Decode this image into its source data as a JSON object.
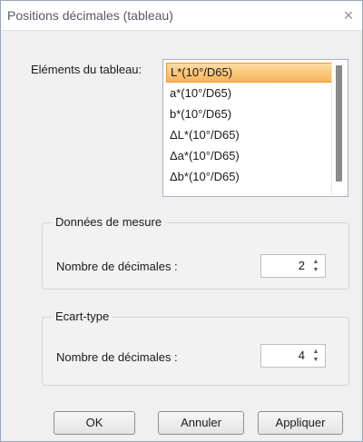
{
  "window": {
    "title": "Positions décimales (tableau)",
    "close_glyph": "×"
  },
  "elements": {
    "label": "Eléments du tableau:",
    "items": [
      {
        "label": "L*(10°/D65)",
        "selected": true
      },
      {
        "label": "a*(10°/D65)",
        "selected": false
      },
      {
        "label": "b*(10°/D65)",
        "selected": false
      },
      {
        "label": "ΔL*(10°/D65)",
        "selected": false
      },
      {
        "label": "Δa*(10°/D65)",
        "selected": false
      },
      {
        "label": "Δb*(10°/D65)",
        "selected": false
      }
    ]
  },
  "measurement_group": {
    "title": "Données de mesure",
    "field_label": "Nombre de décimales :",
    "value": "2"
  },
  "stddev_group": {
    "title": "Ecart-type",
    "field_label": "Nombre de décimales :",
    "value": "4"
  },
  "buttons": {
    "ok": "OK",
    "cancel": "Annuler",
    "apply": "Appliquer"
  },
  "colors": {
    "selection": "#f7b45a",
    "dialog_background": "#f0f0f0"
  }
}
